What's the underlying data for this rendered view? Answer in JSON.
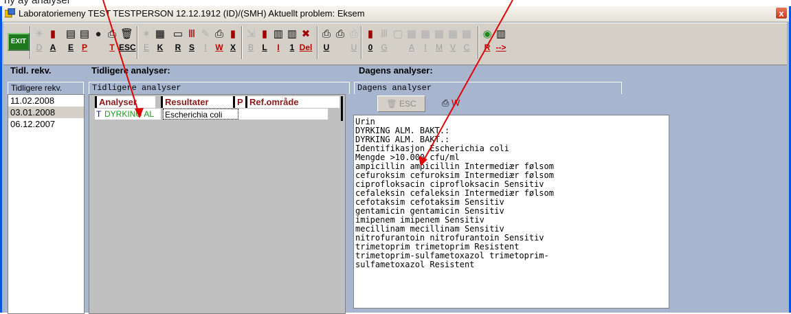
{
  "title": "Laboratoriemeny TEST TESTPERSON 12.12.1912 (ID)/(SMH)   Aktuellt problem: Eksem",
  "close_label": "x",
  "top_caption": "ny     ay          analyser",
  "toolbar": {
    "exit_label": "EXIT",
    "buttons": [
      {
        "icon": "sun-icon",
        "glyph": "☀",
        "label": "D",
        "style": "dim"
      },
      {
        "icon": "tube-icon",
        "glyph": "▮",
        "label": "A",
        "style": ""
      },
      {
        "icon": "clipboard-icon",
        "glyph": "▤",
        "label": "E",
        "style": ""
      },
      {
        "icon": "clipboard-red-icon",
        "glyph": "▤",
        "label": "P",
        "style": "red"
      },
      {
        "icon": "record-icon",
        "glyph": "●",
        "label": "",
        "style": ""
      },
      {
        "icon": "print-redo-icon",
        "glyph": "⎙",
        "label": "T",
        "style": "red"
      },
      {
        "icon": "trash-icon",
        "glyph": "🗑",
        "label": "ESC",
        "style": ""
      },
      {
        "icon": "burst-icon",
        "glyph": "✶",
        "label": "E",
        "style": "dim"
      },
      {
        "icon": "calendar-icon",
        "glyph": "▦",
        "label": "K",
        "style": ""
      },
      {
        "icon": "note-icon",
        "glyph": "▭",
        "label": "R",
        "style": ""
      },
      {
        "icon": "tubes-icon",
        "glyph": "Ⅲ",
        "label": "S",
        "style": ""
      },
      {
        "icon": "pen-icon",
        "glyph": "✎",
        "label": "I",
        "style": "dim"
      },
      {
        "icon": "print-copy-icon",
        "glyph": "⎙",
        "label": "W",
        "style": "red"
      },
      {
        "icon": "tube-x-icon",
        "glyph": "▮",
        "label": "X",
        "style": ""
      },
      {
        "icon": "export-icon",
        "glyph": "⇲",
        "label": "B",
        "style": "dim"
      },
      {
        "icon": "tube-l-icon",
        "glyph": "▮",
        "label": "L",
        "style": ""
      },
      {
        "icon": "book-icon",
        "glyph": "▥",
        "label": "I",
        "style": "red"
      },
      {
        "icon": "book-one-icon",
        "glyph": "▥",
        "label": "1",
        "style": ""
      },
      {
        "icon": "delete-icon",
        "glyph": "✖",
        "label": "Del",
        "style": "red"
      },
      {
        "icon": "printer-u-icon",
        "glyph": "⎙",
        "label": "U",
        "style": ""
      },
      {
        "icon": "printer-icon",
        "glyph": "⎙",
        "label": "",
        "style": ""
      },
      {
        "icon": "printer-dim-icon",
        "glyph": "⎙",
        "label": "U",
        "style": "dim"
      },
      {
        "icon": "tube-zero-icon",
        "glyph": "▮",
        "label": "0",
        "style": ""
      },
      {
        "icon": "rack-icon",
        "glyph": "Ⅲ",
        "label": "G",
        "style": "dim"
      },
      {
        "icon": "frame-icon",
        "glyph": "▢",
        "label": "",
        "style": "dim"
      },
      {
        "icon": "grid-a-icon",
        "glyph": "▦",
        "label": "A",
        "style": "dim"
      },
      {
        "icon": "grid-i-icon",
        "glyph": "▦",
        "label": "I",
        "style": "dim"
      },
      {
        "icon": "grid-m-icon",
        "glyph": "▦",
        "label": "M",
        "style": "dim"
      },
      {
        "icon": "grid-v-icon",
        "glyph": "▦",
        "label": "V",
        "style": "dim"
      },
      {
        "icon": "grid-c-icon",
        "glyph": "▦",
        "label": "C",
        "style": "dim"
      },
      {
        "icon": "radio-r-icon",
        "glyph": "◉",
        "label": "R",
        "style": "red"
      },
      {
        "icon": "arrow-icon",
        "glyph": "▥",
        "label": "-->",
        "style": "red"
      }
    ]
  },
  "headers": {
    "tidl_rekv": "Tidl. rekv.",
    "tidligere_analyser": "Tidligere analyser:",
    "dagens_analyser": "Dagens analyser:"
  },
  "tabs": {
    "tidligere_rekv": "Tidligere rekv.",
    "tidligere_analyser": "Tidligere analyser",
    "dagens_analyser": "Dagens analyser"
  },
  "dates": [
    "11.02.2008",
    "03.01.2008",
    "06.12.2007"
  ],
  "grid": {
    "headers": [
      "Analyser",
      "Resultater",
      "P",
      "Ref.område"
    ],
    "row": {
      "flag": "T",
      "analyse": "DYRKING AL",
      "resultat": "Escherichia coli"
    }
  },
  "dagens": {
    "esc_label": "ESC",
    "w_label": "W",
    "text": "Urin\nDYRKING ALM. BAKT.:\nDYRKING ALM. BAKT.:\nIdentifikasjon Escherichia coli\nMengde >10.000 cfu/ml\nampicillin ampicillin Intermediær følsom\ncefuroksim cefuroksim Intermediær følsom\nciprofloksacin ciprofloksacin Sensitiv\ncefaleksin cefaleksin Intermediær følsom\ncefotaksim cefotaksim Sensitiv\ngentamicin gentamicin Sensitiv\nimipenem imipenem Sensitiv\nmecillinam mecillinam Sensitiv\nnitrofurantoin nitrofurantoin Sensitiv\ntrimetoprim trimetoprim Resistent\ntrimetoprim-sulfametoxazol trimetoprim-\nsulfametoxazol Resistent"
  }
}
